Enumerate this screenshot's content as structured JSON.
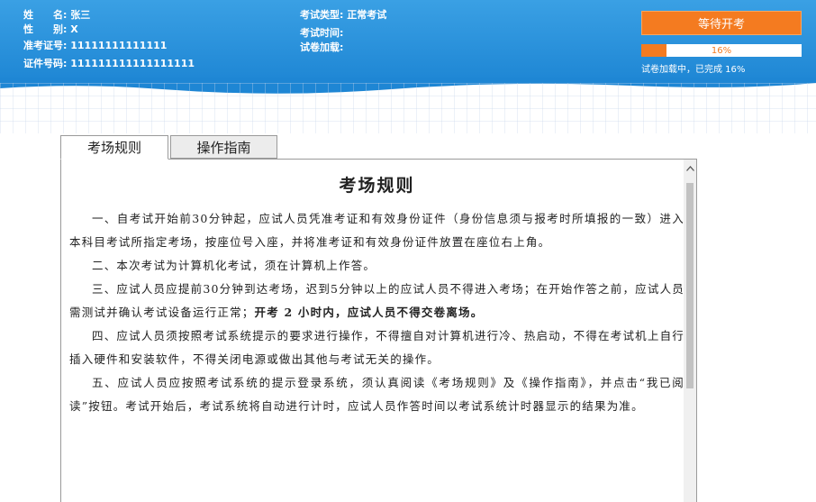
{
  "header": {
    "name_label": "姓　　名:",
    "name_value": "张三",
    "gender_label": "性　　别:",
    "gender_value": "X",
    "ticket_label": "准考证号:",
    "ticket_value": "11111111111111",
    "id_label": "证件号码:",
    "id_value": "111111111111111111",
    "exam_type_label": "考试类型:",
    "exam_type_value": "正常考试",
    "exam_time_label": "考试时间:",
    "exam_time_value": "",
    "paper_loading_label": "试卷加载:",
    "paper_loading_value": "",
    "start_button_label": "等待开考",
    "progress": {
      "percent": 16,
      "text": "16%"
    },
    "loading_status": "试卷加载中，已完成 16%"
  },
  "tabs": [
    {
      "label": "考场规则",
      "active": true
    },
    {
      "label": "操作指南",
      "active": false
    }
  ],
  "rules": {
    "title": "考场规则",
    "paragraphs": {
      "p1": "一、自考试开始前30分钟起，应试人员凭准考证和有效身份证件（身份信息须与报考时所填报的一致）进入本科目考试所指定考场，按座位号入座，并将准考证和有效身份证件放置在座位右上角。",
      "p2": "二、本次考试为计算机化考试，须在计算机上作答。",
      "p3_normal": "三、应试人员应提前30分钟到达考场，迟到5分钟以上的应试人员不得进入考场；在开始作答之前，应试人员需测试并确认考试设备运行正常；",
      "p3_bold": "开考 2 小时内，应试人员不得交卷离场。",
      "p4": "四、应试人员须按照考试系统提示的要求进行操作，不得擅自对计算机进行冷、热启动，不得在考试机上自行插入硬件和安装软件，不得关闭电源或做出其他与考试无关的操作。",
      "p5": "五、应试人员应按照考试系统的提示登录系统，须认真阅读《考场规则》及《操作指南》，并点击“我已阅读”按钮。考试开始后，考试系统将自动进行计时，应试人员作答时间以考试系统计时器显示的结果为准。"
    }
  },
  "scrollbar": {
    "up_arrow_icon": "chevron-up-icon",
    "position_fraction": 0.0
  },
  "colors": {
    "header_blue": "#1e86d4",
    "accent_orange": "#f47b20"
  }
}
